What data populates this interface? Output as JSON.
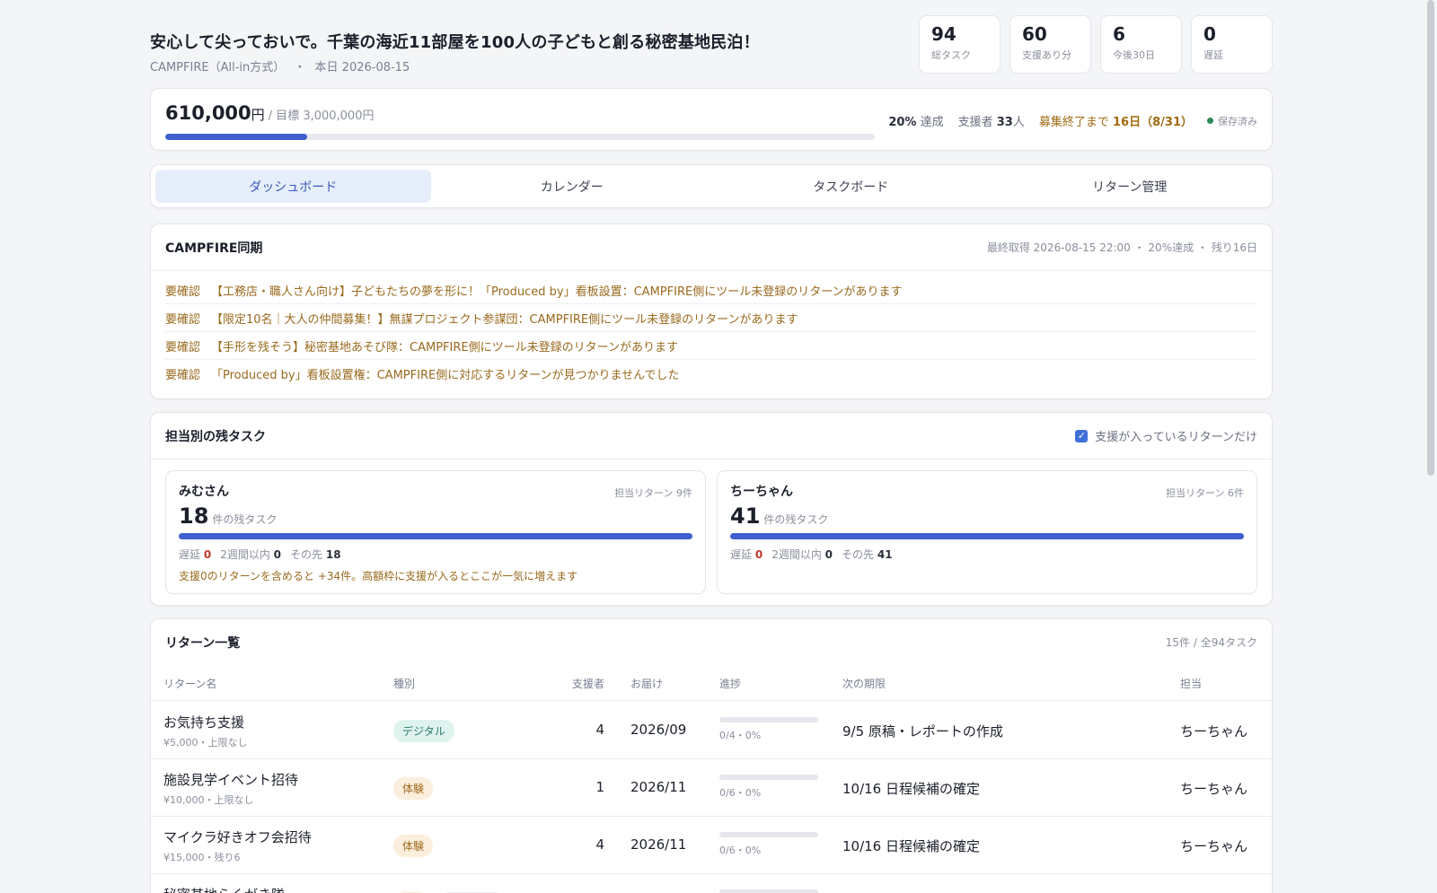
{
  "header": {
    "title": "安心して尖っておいで。千葉の海近11部屋を100人の子どもと創る秘密基地民泊！",
    "platform": "CAMPFIRE（All-in方式）",
    "sep": "・",
    "today": "本日 2026-08-15"
  },
  "stats": [
    {
      "value": "94",
      "label": "総タスク"
    },
    {
      "value": "60",
      "label": "支援あり分"
    },
    {
      "value": "6",
      "label": "今後30日"
    },
    {
      "value": "0",
      "label": "遅延"
    }
  ],
  "funding": {
    "amount": "610,000",
    "currency": "円",
    "goal": "/ 目標 3,000,000円",
    "progress_fraction": 0.2,
    "achieved_pct": "20%",
    "achieved_label": "達成",
    "backers_label": "支援者",
    "backers_value": "33",
    "backers_unit": "人",
    "deadline_label": "募集終了まで",
    "deadline_value": "16日（8/31）",
    "saved": "保存済み",
    "accent": "#3f5fce"
  },
  "tabs": [
    {
      "label": "ダッシュボード",
      "active": true
    },
    {
      "label": "カレンダー"
    },
    {
      "label": "タスクボード"
    },
    {
      "label": "リターン管理"
    }
  ],
  "sync": {
    "title": "CAMPFIRE同期",
    "meta": "最終取得 2026-08-15 22:00 ・ 20%達成 ・ 残り16日",
    "alerts": [
      {
        "tag": "要確認",
        "text": "【工務店・職人さん向け】子どもたちの夢を形に！「Produced by」看板設置：CAMPFIRE側にツール未登録のリターンがあります"
      },
      {
        "tag": "要確認",
        "text": "【限定10名｜大人の仲間募集！】無謀プロジェクト参謀団：CAMPFIRE側にツール未登録のリターンがあります"
      },
      {
        "tag": "要確認",
        "text": "【手形を残そう】秘密基地あそび隊：CAMPFIRE側にツール未登録のリターンがあります"
      },
      {
        "tag": "要確認",
        "text": "「Produced by」看板設置権：CAMPFIRE側に対応するリターンが見つかりませんでした"
      }
    ]
  },
  "assignees": {
    "title": "担当別の残タスク",
    "filter_label": "支援が入っているリターンだけ",
    "filter_checked": true,
    "people": [
      {
        "name": "みむさん",
        "returns": "担当リターン 9件",
        "remaining": "18",
        "remaining_unit": "件の残タスク",
        "late_label": "遅延",
        "late": "0",
        "two_weeks_label": "2週間以内",
        "two_weeks": "0",
        "later_label": "その先",
        "later": "18",
        "note": "支援0のリターンを含めると +34件。高額枠に支援が入るとここが一気に増えます"
      },
      {
        "name": "ちーちゃん",
        "returns": "担当リターン 6件",
        "remaining": "41",
        "remaining_unit": "件の残タスク",
        "late_label": "遅延",
        "late": "0",
        "two_weeks_label": "2週間以内",
        "two_weeks": "0",
        "later_label": "その先",
        "later": "41",
        "note": ""
      }
    ]
  },
  "returns": {
    "title": "リターン一覧",
    "summary": "15件 / 全94タスク",
    "columns": {
      "name": "リターン名",
      "type": "種別",
      "backers": "支援者",
      "delivery": "お届け",
      "progress": "進捗",
      "next": "次の期限",
      "owner": "担当"
    },
    "rows": [
      {
        "name": "お気持ち支援",
        "sub": "¥5,000・上限なし",
        "type": "デジタル",
        "type_kind": "digital",
        "backers": "4",
        "delivery": "2026/09",
        "progress": "0/4・0%",
        "next": "9/5 原稿・レポートの作成",
        "owner": "ちーちゃん"
      },
      {
        "name": "施設見学イベント招待",
        "sub": "¥10,000・上限なし",
        "type": "体験",
        "type_kind": "exp",
        "backers": "1",
        "delivery": "2026/11",
        "progress": "0/6・0%",
        "next": "10/16 日程候補の確定",
        "owner": "ちーちゃん"
      },
      {
        "name": "マイクラ好きオフ会招待",
        "sub": "¥15,000・残り6",
        "type": "体験",
        "type_kind": "exp",
        "backers": "4",
        "delivery": "2026/11",
        "progress": "0/6・0%",
        "next": "10/16 日程候補の確定",
        "owner": "ちーちゃん"
      },
      {
        "name": "秘密基地らくがき隊",
        "sub": "",
        "type": "",
        "type_kind": "partial",
        "backers": "",
        "delivery": "",
        "progress": "",
        "next": "",
        "owner": ""
      }
    ]
  }
}
